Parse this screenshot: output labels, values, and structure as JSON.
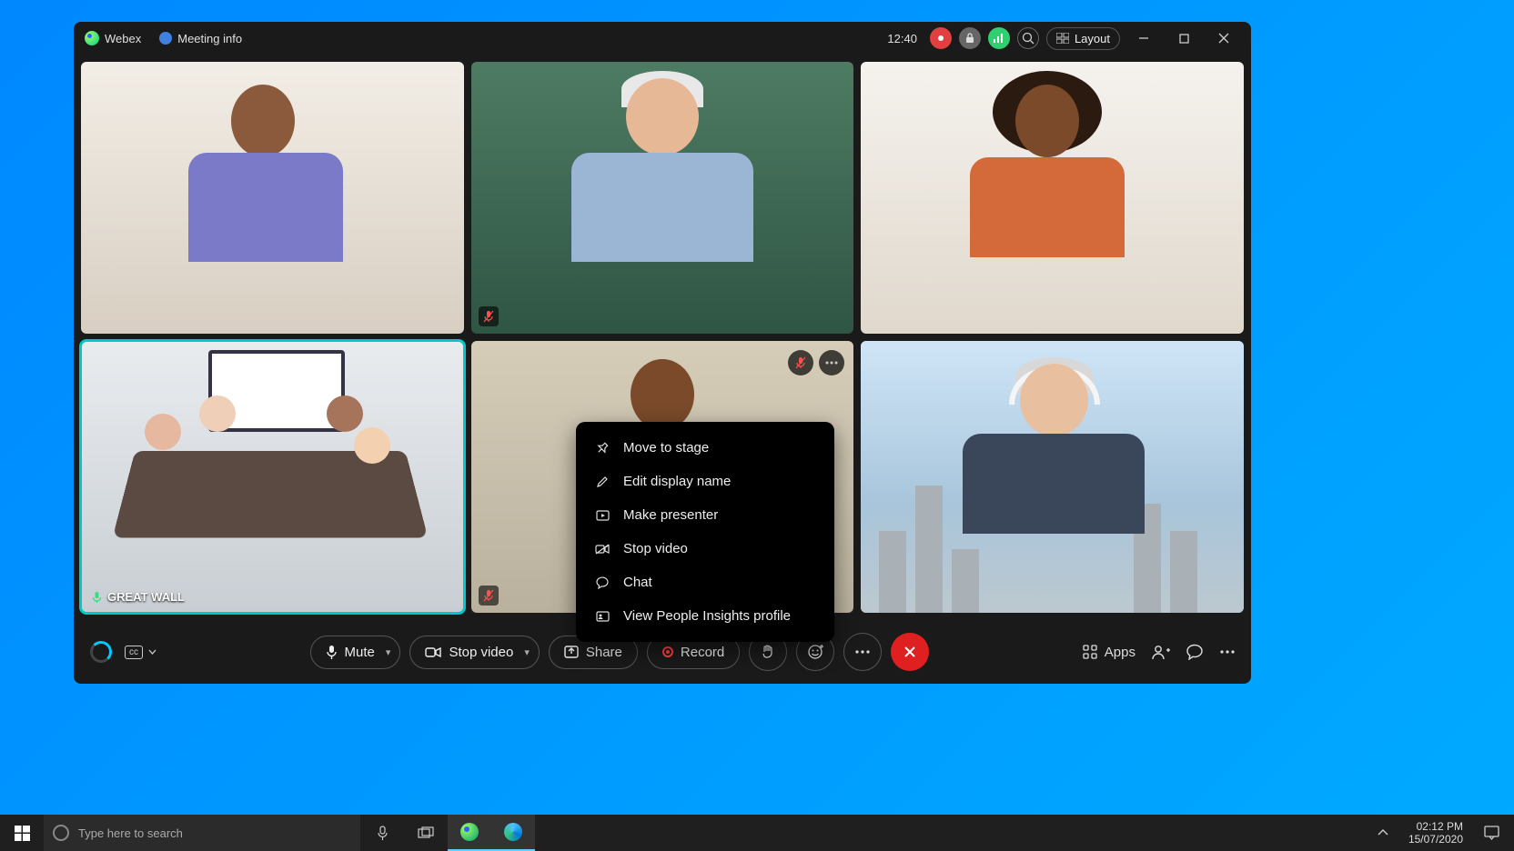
{
  "titlebar": {
    "app_name": "Webex",
    "meeting_info": "Meeting info",
    "clock": "12:40",
    "layout_label": "Layout"
  },
  "participants": [
    {
      "muted": false,
      "selected": false
    },
    {
      "muted": true,
      "selected": false
    },
    {
      "muted": false,
      "selected": false
    },
    {
      "muted": false,
      "selected": true,
      "label": "GREAT WALL"
    },
    {
      "muted": true,
      "selected": false,
      "actions_visible": true
    },
    {
      "muted": false,
      "selected": false
    }
  ],
  "context_menu": {
    "items": [
      {
        "icon": "pin",
        "label": "Move to stage"
      },
      {
        "icon": "pencil",
        "label": "Edit display name"
      },
      {
        "icon": "presenter",
        "label": "Make presenter"
      },
      {
        "icon": "video-off",
        "label": "Stop video"
      },
      {
        "icon": "chat",
        "label": "Chat"
      },
      {
        "icon": "profile",
        "label": "View People Insights profile"
      }
    ]
  },
  "controls": {
    "mute": "Mute",
    "stop_video": "Stop video",
    "share": "Share",
    "record": "Record",
    "apps": "Apps"
  },
  "taskbar": {
    "search_placeholder": "Type here to search",
    "time": "02:12 PM",
    "date": "15/07/2020"
  }
}
